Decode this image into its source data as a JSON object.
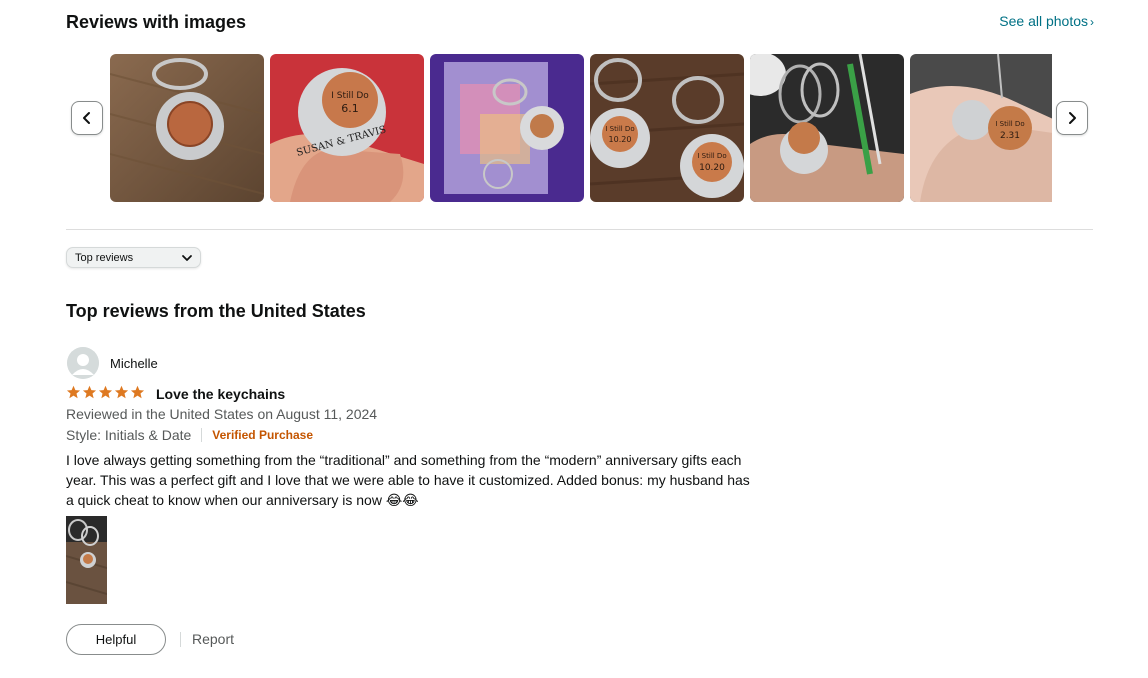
{
  "images_section": {
    "title": "Reviews with images",
    "see_all": "See all photos",
    "see_all_chevron": "›",
    "thumbnails": [
      {
        "alt_icon": "keychain-photo",
        "text_lines": [
          "",
          ""
        ]
      },
      {
        "alt_icon": "keychain-photo",
        "text_lines": [
          "I Still Do",
          "6.1",
          "SUSAN & TRAVIS"
        ]
      },
      {
        "alt_icon": "keychain-photo",
        "text_lines": [
          "",
          ""
        ]
      },
      {
        "alt_icon": "keychain-photo",
        "text_lines": [
          "I Still Do",
          "10.20"
        ]
      },
      {
        "alt_icon": "keychain-photo",
        "text_lines": [
          "",
          ""
        ]
      },
      {
        "alt_icon": "keychain-photo",
        "text_lines": [
          "I Still Do",
          "2.31"
        ]
      }
    ]
  },
  "sort": {
    "selected": "Top reviews"
  },
  "reviews_section": {
    "heading": "Top reviews from the United States"
  },
  "review": {
    "reviewer": "Michelle",
    "rating": 5,
    "title": "Love the keychains",
    "date_line": "Reviewed in the United States on August 11, 2024",
    "style": "Style: Initials & Date",
    "verified": "Verified Purchase",
    "body": "I love always getting something from the “traditional” and something from the “modern” anniversary gifts each year. This was a perfect gift and I love that we were able to have it customized. Added bonus: my husband has a quick cheat to know when our anniversary is now 😂😂",
    "helpful_label": "Helpful",
    "report_label": "Report"
  },
  "colors": {
    "link": "#007185",
    "star": "#de7921",
    "verified": "#c45500",
    "muted": "#565959"
  }
}
